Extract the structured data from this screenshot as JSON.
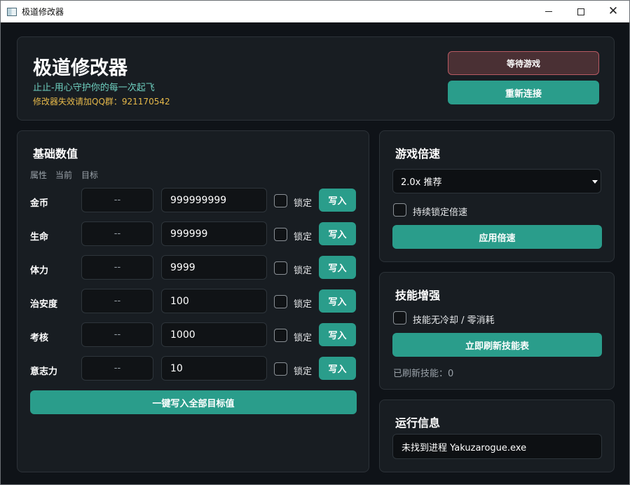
{
  "window": {
    "title": "极道修改器"
  },
  "header": {
    "title": "极道修改器",
    "subtitle": "止止-用心守护你的每一次起飞",
    "qq_notice": "修改器失效请加QQ群：921170542",
    "status_button": "等待游戏",
    "reconnect_button": "重新连接"
  },
  "stats": {
    "title": "基础数值",
    "columns": [
      "属性",
      "当前",
      "目标"
    ],
    "lock_label": "锁定",
    "write_label": "写入",
    "rows": [
      {
        "name": "金币",
        "current": "--",
        "target": "999999999"
      },
      {
        "name": "生命",
        "current": "--",
        "target": "999999"
      },
      {
        "name": "体力",
        "current": "--",
        "target": "9999"
      },
      {
        "name": "治安度",
        "current": "--",
        "target": "100"
      },
      {
        "name": "考核",
        "current": "--",
        "target": "1000"
      },
      {
        "name": "意志力",
        "current": "--",
        "target": "10"
      }
    ],
    "write_all_button": "一键写入全部目标值"
  },
  "speed": {
    "title": "游戏倍速",
    "selected": "2.0x 推荐",
    "lock_label": "持续锁定倍速",
    "apply_button": "应用倍速"
  },
  "skills": {
    "title": "技能增强",
    "nocd_label": "技能无冷却 / 零消耗",
    "refresh_button": "立即刷新技能表",
    "refreshed_text": "已刷新技能：0"
  },
  "runtime": {
    "title": "运行信息",
    "message": "未找到进程 Yakuzarogue.exe"
  },
  "colors": {
    "accent": "#2a9d8b",
    "background": "#0f1318",
    "card": "#181d22",
    "subtitle": "#6fd1c1",
    "notice": "#e6b94a",
    "status_border": "#b85a63"
  }
}
